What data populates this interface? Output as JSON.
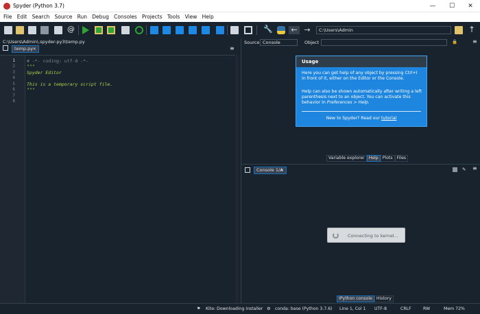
{
  "window": {
    "title": "Spyder (Python 3.7)",
    "minimize_label": "—",
    "maximize_label": "☐",
    "close_label": "✕"
  },
  "menu": [
    "File",
    "Edit",
    "Search",
    "Source",
    "Run",
    "Debug",
    "Consoles",
    "Projects",
    "Tools",
    "View",
    "Help"
  ],
  "toolbar": {
    "icons": [
      "new-file",
      "open-file",
      "save-file",
      "save-all",
      "file-list",
      "at-symbol",
      "run",
      "run-cell",
      "run-cell-advance",
      "run-selection",
      "rerun",
      "debug",
      "debug-step",
      "debug-step-into",
      "debug-step-return",
      "debug-continue",
      "debug-stop",
      "maximize-pane",
      "fullscreen",
      "preferences-wrench",
      "python-path",
      "back-arrow",
      "forward-arrow",
      "browse-folder",
      "parent-folder"
    ],
    "working_dir": "C:\\Users\\Admin"
  },
  "editor": {
    "path": "C:\\Users\\Admin\\.spyder-py3\\temp.py",
    "tab_label": "temp.py",
    "tab_close": "×",
    "line_numbers": [
      "1",
      "2",
      "3",
      "4",
      "5",
      "6",
      "7",
      "8"
    ],
    "lines": [
      {
        "text": "# -*- coding: utf-8 -*-",
        "kind": "comment"
      },
      {
        "text": "\"\"\"",
        "kind": "doc"
      },
      {
        "text": "Spyder Editor",
        "kind": "doc"
      },
      {
        "text": "",
        "kind": "doc"
      },
      {
        "text": "This is a temporary script file.",
        "kind": "doc"
      },
      {
        "text": "\"\"\"",
        "kind": "doc"
      },
      {
        "text": "",
        "kind": "doc"
      },
      {
        "text": "",
        "kind": "doc"
      }
    ]
  },
  "help": {
    "source_label": "Source",
    "source_value": "Console",
    "object_label": "Object",
    "usage_title": "Usage",
    "para1": "Here you can get help of any object by pressing Ctrl+I in front of it, either on the Editor or the Console.",
    "para2_a": "Help can also be shown automatically after writing a left parenthesis next to an object. You can activate this behavior in ",
    "para2_em": "Preferences > Help",
    "para2_b": ".",
    "new_to_prefix": "New to Spyder? Read our ",
    "tutorial_link": "tutorial",
    "tabs": [
      {
        "label": "Variable explorer",
        "active": false
      },
      {
        "label": "Help",
        "active": true
      },
      {
        "label": "Plots",
        "active": false
      },
      {
        "label": "Files",
        "active": false
      }
    ]
  },
  "console": {
    "tab_label": "Console 1/A",
    "tab_close": "×",
    "connecting": "Connecting to kernel...",
    "tabs": [
      {
        "label": "IPython console",
        "active": true
      },
      {
        "label": "History",
        "active": false
      }
    ]
  },
  "status": {
    "kite": "Kite: Downloading installer",
    "conda": "conda: base (Python 3.7.6)",
    "position": "Line 1, Col 1",
    "encoding": "UTF-8",
    "eol": "CRLF",
    "permissions": "RW",
    "memory": "Mem 72%"
  },
  "colors": {
    "background": "#19232d",
    "accent": "#1a72bb",
    "usage_box": "#1f86e0",
    "docstring": "#b7d34d"
  }
}
